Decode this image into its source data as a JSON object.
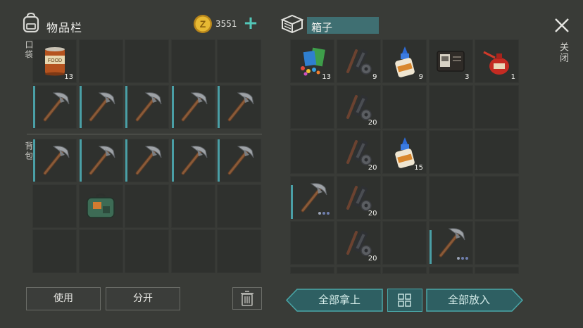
{
  "inventory": {
    "title": "物品栏",
    "currency": "3551",
    "pocket_label": "口袋",
    "backpack_label": "背包",
    "pocket": [
      {
        "item": "canned-food-icon",
        "qty": "13"
      },
      {
        "item": ""
      },
      {
        "item": ""
      },
      {
        "item": ""
      },
      {
        "item": ""
      },
      {
        "item": "pickaxe-icon",
        "qty": ""
      },
      {
        "item": "pickaxe-icon",
        "qty": ""
      },
      {
        "item": "pickaxe-icon",
        "qty": ""
      },
      {
        "item": "pickaxe-icon",
        "qty": ""
      },
      {
        "item": "pickaxe-icon",
        "qty": ""
      }
    ],
    "backpack": [
      {
        "item": "pickaxe-icon",
        "qty": ""
      },
      {
        "item": "pickaxe-icon",
        "qty": ""
      },
      {
        "item": "pickaxe-icon",
        "qty": ""
      },
      {
        "item": "pickaxe-icon",
        "qty": ""
      },
      {
        "item": "pickaxe-icon",
        "qty": ""
      },
      {
        "item": ""
      },
      {
        "item": "medkit-bag-icon",
        "qty": ""
      },
      {
        "item": ""
      },
      {
        "item": ""
      },
      {
        "item": ""
      },
      {
        "item": ""
      },
      {
        "item": ""
      },
      {
        "item": ""
      },
      {
        "item": ""
      },
      {
        "item": ""
      }
    ],
    "use_label": "使用",
    "split_label": "分开"
  },
  "box": {
    "title": "箱子",
    "close_label": "关闭",
    "take_all_label": "全部拿上",
    "put_all_label": "全部放入",
    "slots": [
      {
        "item": "craft-parts-icon",
        "qty": "13"
      },
      {
        "item": "gun-parts-icon",
        "qty": "9"
      },
      {
        "item": "glue-icon",
        "qty": "9"
      },
      {
        "item": "leather-wallet-icon",
        "qty": "3"
      },
      {
        "item": "oil-can-icon",
        "qty": "1"
      },
      {
        "item": ""
      },
      {
        "item": "gun-parts-icon",
        "qty": "20"
      },
      {
        "item": ""
      },
      {
        "item": ""
      },
      {
        "item": ""
      },
      {
        "item": ""
      },
      {
        "item": "gun-parts-icon",
        "qty": "20"
      },
      {
        "item": "glue-icon",
        "qty": "15"
      },
      {
        "item": ""
      },
      {
        "item": ""
      },
      {
        "item": "pickaxe-icon",
        "qty": ""
      },
      {
        "item": "gun-parts-icon",
        "qty": "20"
      },
      {
        "item": ""
      },
      {
        "item": ""
      },
      {
        "item": ""
      },
      {
        "item": ""
      },
      {
        "item": "gun-parts-icon",
        "qty": "20"
      },
      {
        "item": ""
      },
      {
        "item": "pickaxe-icon",
        "qty": ""
      },
      {
        "item": ""
      }
    ]
  },
  "colors": {
    "accent": "#4aa7a8",
    "durability": "#4a9fa6",
    "plus": "#53c7b8"
  }
}
